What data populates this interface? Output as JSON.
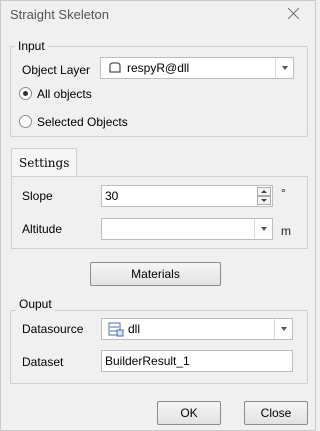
{
  "window": {
    "title": "Straight Skeleton"
  },
  "input": {
    "legend": "Input",
    "object_layer_label": "Object Layer",
    "object_layer_value": "respyR@dll",
    "options": [
      {
        "label": "All objects",
        "checked": true
      },
      {
        "label": "Selected Objects",
        "checked": false
      }
    ]
  },
  "settings": {
    "tab_label": "Settings",
    "slope_label": "Slope",
    "slope_value": "30",
    "slope_unit": "°",
    "altitude_label": "Altitude",
    "altitude_value": "",
    "altitude_unit": "m"
  },
  "materials_button": "Materials",
  "output": {
    "legend": "Ouput",
    "datasource_label": "Datasource",
    "datasource_value": "dll",
    "dataset_label": "Dataset",
    "dataset_value": "BuilderResult_1"
  },
  "buttons": {
    "ok": "OK",
    "close": "Close"
  }
}
